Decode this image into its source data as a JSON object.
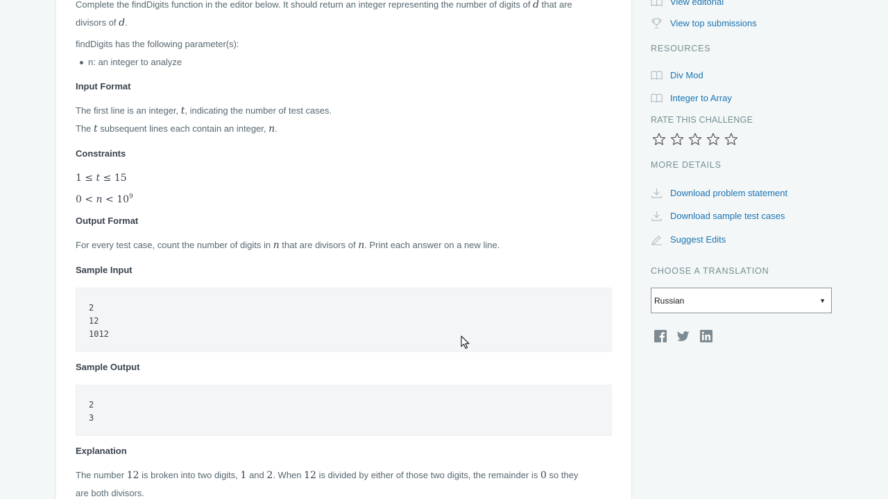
{
  "problem": {
    "intro_prefix": "Complete the findDigits function in the editor below. It should return an integer representing the number of digits of",
    "intro_var": "d",
    "intro_suffix": "that are",
    "intro_line2_prefix": "divisors of",
    "intro_line2_var": "d",
    "period": ".",
    "params_heading": "findDigits has the following parameter(s):",
    "param_n": "n: an integer to analyze",
    "input_format_title": "Input Format",
    "input_line1_prefix": "The first line is an integer,",
    "input_line1_var": "t",
    "input_line1_suffix": ", indicating the number of test cases.",
    "input_line2_prefix": "The",
    "input_line2_var": "t",
    "input_line2_mid": "subsequent lines each contain an integer,",
    "input_line2_var2": "n",
    "constraints_title": "Constraints",
    "constraint1": {
      "a": "1 ≤ ",
      "v": "t",
      "b": " ≤ 15"
    },
    "constraint2": {
      "a": "0 < ",
      "v": "n",
      "b": " < 10",
      "sup": "9"
    },
    "output_format_title": "Output Format",
    "output_prefix": "For every test case, count the number of digits in",
    "output_var": "n",
    "output_mid": "that are divisors of",
    "output_var2": "n",
    "output_suffix": ". Print each answer on a new line.",
    "sample_input_title": "Sample Input",
    "sample_input": [
      "2",
      "12",
      "1012"
    ],
    "sample_output_title": "Sample Output",
    "sample_output": [
      "2",
      "3"
    ],
    "explanation_title": "Explanation",
    "expl_1": "The number",
    "expl_n1": "12",
    "expl_2": "is broken into two digits,",
    "expl_n2": "1",
    "expl_3": "and",
    "expl_n3": "2",
    "expl_4": ". When",
    "expl_n4": "12",
    "expl_5": "is divided by either of those two digits, the remainder is",
    "expl_n5": "0",
    "expl_6": "so they",
    "expl_line2": "are both divisors."
  },
  "sidebar": {
    "view_editorial": "View editorial",
    "view_top_submissions": "View top submissions",
    "resources_heading": "RESOURCES",
    "resource_1": "Div Mod",
    "resource_2": "Integer to Array",
    "rate_heading": "RATE THIS CHALLENGE",
    "more_details_heading": "MORE DETAILS",
    "download_statement": "Download problem statement",
    "download_tests": "Download sample test cases",
    "suggest_edits": "Suggest Edits",
    "translation_heading": "CHOOSE A TRANSLATION",
    "translation_selected": "Russian",
    "select_arrow": "▼"
  },
  "icons": {
    "book": "book-icon",
    "trophy": "trophy-icon",
    "star": "star-outline-icon",
    "download": "download-icon",
    "pencil": "pencil-icon",
    "facebook": "facebook-icon",
    "twitter": "twitter-icon",
    "linkedin": "linkedin-icon"
  },
  "colors": {
    "link": "#1b73b3",
    "text": "#576871",
    "heading": "#39424e",
    "icon_gray": "#b7c0c5",
    "social_gray": "#7d8a91"
  }
}
